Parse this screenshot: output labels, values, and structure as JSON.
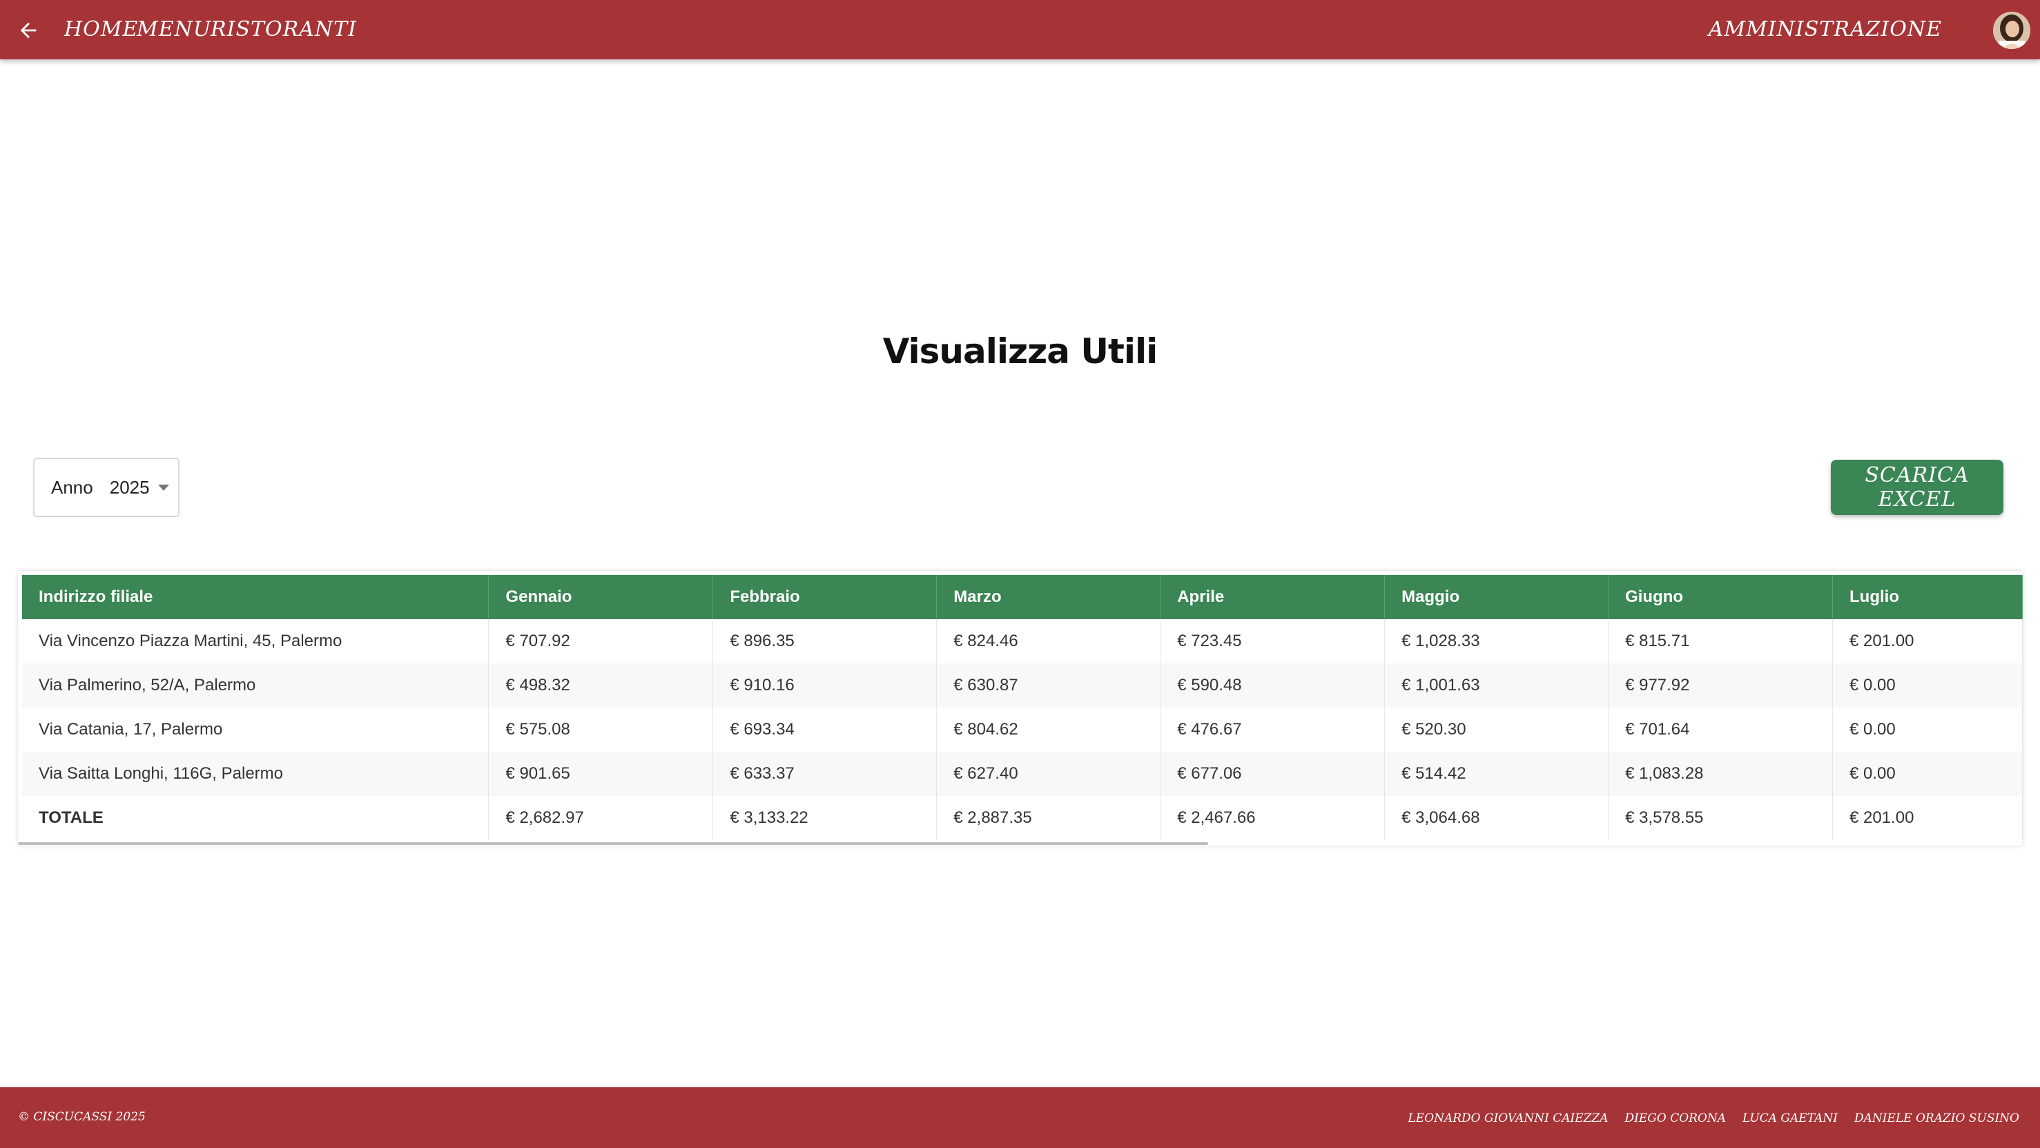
{
  "nav": {
    "back_icon": "arrow-left-icon",
    "links": [
      "HOME",
      "MENU",
      "RISTORANTI"
    ],
    "admin": "AMMINISTRAZIONE",
    "avatar_icon": "user-avatar"
  },
  "page": {
    "title": "Visualizza Utili"
  },
  "filter": {
    "label": "Anno",
    "value": "2025"
  },
  "actions": {
    "download_label": "SCARICA EXCEL"
  },
  "table": {
    "headers": [
      "Indirizzo filiale",
      "Gennaio",
      "Febbraio",
      "Marzo",
      "Aprile",
      "Maggio",
      "Giugno",
      "Luglio"
    ],
    "rows": [
      [
        "Via Vincenzo Piazza Martini, 45, Palermo",
        "€ 707.92",
        "€ 896.35",
        "€ 824.46",
        "€ 723.45",
        "€ 1,028.33",
        "€ 815.71",
        "€ 201.00"
      ],
      [
        "Via Palmerino, 52/A, Palermo",
        "€ 498.32",
        "€ 910.16",
        "€ 630.87",
        "€ 590.48",
        "€ 1,001.63",
        "€ 977.92",
        "€ 0.00"
      ],
      [
        "Via Catania, 17, Palermo",
        "€ 575.08",
        "€ 693.34",
        "€ 804.62",
        "€ 476.67",
        "€ 520.30",
        "€ 701.64",
        "€ 0.00"
      ],
      [
        "Via Saitta Longhi, 116G, Palermo",
        "€ 901.65",
        "€ 633.37",
        "€ 627.40",
        "€ 677.06",
        "€ 514.42",
        "€ 1,083.28",
        "€ 0.00"
      ],
      [
        "TOTALE",
        "€ 2,682.97",
        "€ 3,133.22",
        "€ 2,887.35",
        "€ 2,467.66",
        "€ 3,064.68",
        "€ 3,578.55",
        "€ 201.00"
      ]
    ]
  },
  "footer": {
    "copyright": "© CISCUCASSI 2025",
    "authors": [
      "LEONARDO GIOVANNI CAIEZZA",
      "DIEGO CORONA",
      "LUCA GAETANI",
      "DANIELE ORAZIO SUSINO"
    ]
  },
  "colors": {
    "primary": "#a63336",
    "accent": "#3a8654"
  }
}
